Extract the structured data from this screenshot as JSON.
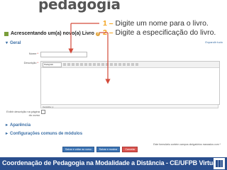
{
  "header": {
    "logo_text": "pedagogia"
  },
  "instructions": [
    {
      "num": "1 –",
      "text": " Digite um nome para o livro."
    },
    {
      "num": "2 –",
      "text": " Digite a especificação do livro."
    }
  ],
  "form": {
    "title": "Acrescentando um(a) novo(a) Livro",
    "help": "?",
    "expand_all": "Expandir tudo",
    "sections": {
      "geral": "Geral",
      "aparencia": "Aparência",
      "config": "Configurações comuns de módulos"
    },
    "name_label": "Nome",
    "description_label": "Descrição",
    "toolbar_select": "Parágrafo",
    "status_path": "Caminho: p",
    "show_desc_label": "Exibir descrição na página do curso",
    "required_note": "Este formulário contém campos obrigatórios marcados com *",
    "buttons": [
      "Salvar e voltar ao curso",
      "Salvar e mostrar",
      "Cancelar"
    ]
  },
  "footer": {
    "text": "Coordenação de Pedagogia na Modalidade a Distância - CE/UFPB Virtual"
  },
  "colors": {
    "accent": "#f3a21a",
    "link": "#3a6ea5",
    "footer_bg": "#2a4f8e",
    "arrow": "#d34a3a"
  }
}
